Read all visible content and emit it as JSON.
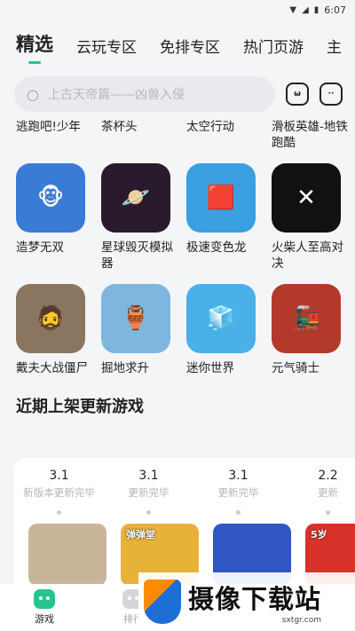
{
  "status": {
    "time": "6:07"
  },
  "tabs": [
    {
      "label": "精选",
      "active": true
    },
    {
      "label": "云玩专区"
    },
    {
      "label": "免排专区"
    },
    {
      "label": "热门页游"
    },
    {
      "label": "主"
    }
  ],
  "search": {
    "placeholder": "上古天帝篇——凶兽入侵"
  },
  "partial_row": [
    "逃跑吧!少年",
    "茶杯头",
    "太空行动",
    "滑板英雄-地铁跑酷"
  ],
  "games": [
    {
      "name": "造梦无双",
      "color": "#3a7bd5",
      "icon": "🐵"
    },
    {
      "name": "星球毁灭模拟器",
      "color": "#2a1a2e",
      "icon": "🪐"
    },
    {
      "name": "极速变色龙",
      "color": "#3aa0e0",
      "icon": "🟥"
    },
    {
      "name": "火柴人至高对决",
      "color": "#111111",
      "icon": "✕"
    },
    {
      "name": "戴夫大战僵尸",
      "color": "#8a7560",
      "icon": "🧔"
    },
    {
      "name": "掘地求升",
      "color": "#7fb6e0",
      "icon": "🏺"
    },
    {
      "name": "迷你世界",
      "color": "#4ab0e8",
      "icon": "🧊"
    },
    {
      "name": "元气骑士",
      "color": "#b33a2a",
      "icon": "🚂"
    }
  ],
  "section": {
    "title": "近期上架更新游戏"
  },
  "timeline": [
    {
      "version": "3.1",
      "desc": "新版本更新完毕"
    },
    {
      "version": "3.1",
      "desc": "更新完毕"
    },
    {
      "version": "3.1",
      "desc": "更新完毕"
    },
    {
      "version": "2.2",
      "desc": "更新"
    }
  ],
  "covers": [
    {
      "color": "#c9b69a",
      "badge": ""
    },
    {
      "color": "#e8b23a",
      "badge": "弹弹堂"
    },
    {
      "color": "#2f56c2",
      "badge": ""
    },
    {
      "color": "#d9322a",
      "badge": "5岁"
    }
  ],
  "nav": [
    {
      "label": "游戏",
      "active": true
    },
    {
      "label": "排行",
      "active": false
    }
  ],
  "watermark": {
    "main": "摄像下载站",
    "sub": "sxtgr.com"
  }
}
